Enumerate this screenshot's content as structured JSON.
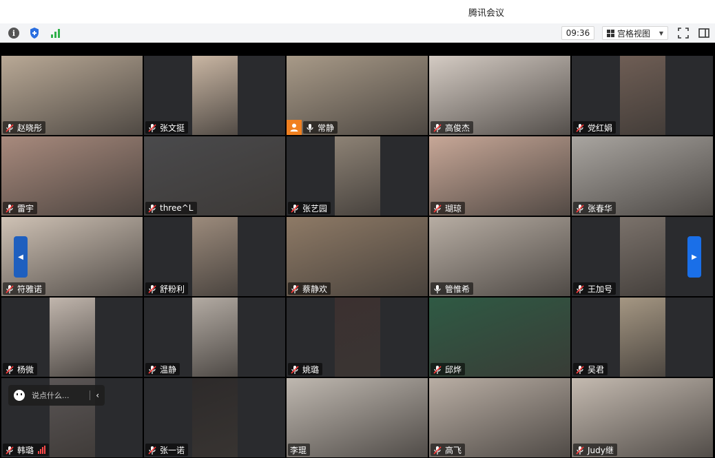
{
  "window": {
    "title": "腾讯会议"
  },
  "toolbar": {
    "time": "09:36",
    "view_label": "宫格视图",
    "icons": [
      "info-icon",
      "shield-icon",
      "signal-icon",
      "fullscreen-icon",
      "sidebar-icon"
    ]
  },
  "colors": {
    "active_border": "#3fbf5f",
    "host_badge": "#f08020",
    "nav_arrow": "#1a6fe8"
  },
  "participants": [
    {
      "name": "赵晓彤",
      "bg": "#b9a996",
      "narrow": false
    },
    {
      "name": "张文挺",
      "bg": "#c9b6a3",
      "narrow": true
    },
    {
      "name": "常静",
      "bg": "#a89a88",
      "narrow": false,
      "host": true,
      "active": true
    },
    {
      "name": "高俊杰",
      "bg": "#d4cbc3",
      "narrow": false
    },
    {
      "name": "党红娟",
      "bg": "#6f5e55",
      "narrow": true
    },
    {
      "name": "雷宇",
      "bg": "#a88a7d",
      "narrow": false
    },
    {
      "name": "three^L",
      "bg": "#4a4a4c",
      "narrow": false
    },
    {
      "name": "张艺园",
      "bg": "#8d8275",
      "narrow": true
    },
    {
      "name": "瑚琼",
      "bg": "#c7a797",
      "narrow": false
    },
    {
      "name": "张春华",
      "bg": "#a9a5a0",
      "narrow": false
    },
    {
      "name": "符雅诺",
      "bg": "#cfc2b5",
      "narrow": false
    },
    {
      "name": "舒粉利",
      "bg": "#9c8b7c",
      "narrow": true
    },
    {
      "name": "蔡静欢",
      "bg": "#8e7a66",
      "narrow": false
    },
    {
      "name": "管惟希",
      "bg": "#b7ada3",
      "narrow": false
    },
    {
      "name": "王加号",
      "bg": "#7b726b",
      "narrow": true
    },
    {
      "name": "杨微",
      "bg": "#c1b6ad",
      "narrow": true
    },
    {
      "name": "温静",
      "bg": "#b3aba3",
      "narrow": true
    },
    {
      "name": "姚璐",
      "bg": "#3b3030",
      "narrow": true
    },
    {
      "name": "邱烨",
      "bg": "#2f5a44",
      "narrow": false
    },
    {
      "name": "吴君",
      "bg": "#a59783",
      "narrow": true
    },
    {
      "name": "韩璐",
      "bg": "#5b5656",
      "narrow": true,
      "signal": true
    },
    {
      "name": "张一诺",
      "bg": "#2d2a2a",
      "narrow": true
    },
    {
      "name": "李琨",
      "bg": "#bfb8b0",
      "narrow": false,
      "nomic": true
    },
    {
      "name": "高飞",
      "bg": "#b9aea4",
      "narrow": false
    },
    {
      "name": "Judy继",
      "bg": "#c4bab0",
      "narrow": false
    }
  ],
  "chat": {
    "placeholder": "说点什么..."
  }
}
